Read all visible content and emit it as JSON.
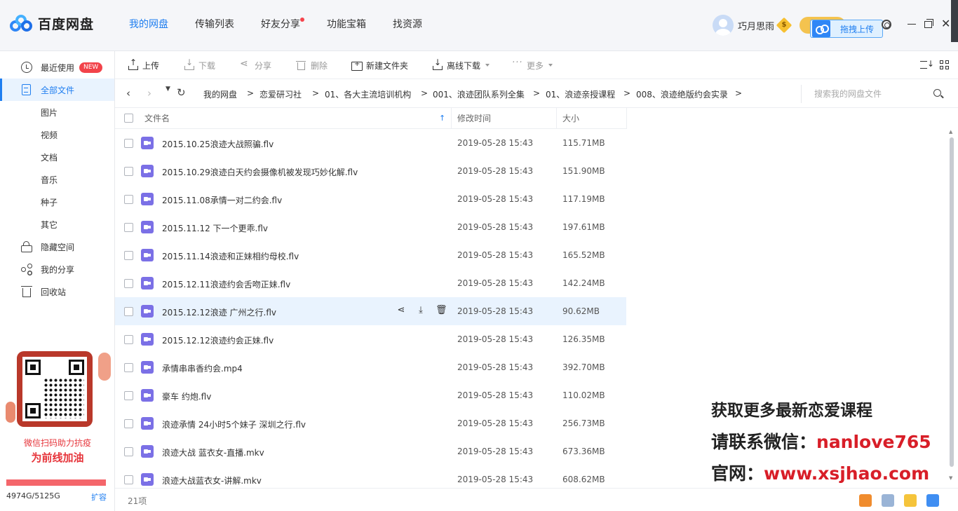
{
  "app": {
    "title": "百度网盘"
  },
  "topnav": [
    {
      "label": "我的网盘",
      "active": true
    },
    {
      "label": "传输列表",
      "active": false
    },
    {
      "label": "好友分享",
      "active": false,
      "dot": true
    },
    {
      "label": "功能宝箱",
      "active": false
    },
    {
      "label": "找资源",
      "active": false
    }
  ],
  "user": {
    "name": "巧月思雨",
    "coin": "$"
  },
  "upload_button": "拖拽上传",
  "sidebar": {
    "items": [
      {
        "label": "最近使用",
        "icon": "clock-icon",
        "badge": "NEW"
      },
      {
        "label": "全部文件",
        "icon": "document-icon",
        "active": true
      },
      {
        "label": "图片"
      },
      {
        "label": "视频"
      },
      {
        "label": "文档"
      },
      {
        "label": "音乐"
      },
      {
        "label": "种子"
      },
      {
        "label": "其它"
      },
      {
        "label": "隐藏空间",
        "icon": "lock-icon"
      },
      {
        "label": "我的分享",
        "icon": "share-icon"
      },
      {
        "label": "回收站",
        "icon": "trash-icon"
      }
    ],
    "promo": {
      "line1": "微信扫码助力抗疫",
      "line2": "为前线加油"
    },
    "quota": {
      "text": "4974G/5125G",
      "expand": "扩容",
      "used_fraction": 0.9705
    }
  },
  "toolbar": {
    "upload": "上传",
    "download": "下载",
    "share": "分享",
    "delete": "删除",
    "new_folder": "新建文件夹",
    "offline_download": "离线下载",
    "more": "更多"
  },
  "path": {
    "crumbs": [
      "我的网盘",
      "恋爱研习社",
      "01、各大主流培训机构",
      "001、浪迹团队系列全集",
      "01、浪迹亲授课程",
      "008、浪迹绝版约会实录"
    ],
    "search_placeholder": "搜索我的网盘文件"
  },
  "list": {
    "headers": {
      "name": "文件名",
      "modified": "修改时间",
      "size": "大小"
    },
    "files": [
      {
        "name": "2015.10.25浪迹大战照骗.flv",
        "modified": "2019-05-28 15:43",
        "size": "115.71MB"
      },
      {
        "name": "2015.10.29浪迹白天约会摄像机被发现巧妙化解.flv",
        "modified": "2019-05-28 15:43",
        "size": "151.90MB"
      },
      {
        "name": "2015.11.08承情一对二约会.flv",
        "modified": "2019-05-28 15:43",
        "size": "117.19MB"
      },
      {
        "name": "2015.11.12 下一个更乖.flv",
        "modified": "2019-05-28 15:43",
        "size": "197.61MB"
      },
      {
        "name": "2015.11.14浪迹和正妹相约母校.flv",
        "modified": "2019-05-28 15:43",
        "size": "165.52MB"
      },
      {
        "name": "2015.12.11浪迹约会舌吻正妹.flv",
        "modified": "2019-05-28 15:43",
        "size": "142.24MB"
      },
      {
        "name": "2015.12.12浪迹 广州之行.flv",
        "modified": "2019-05-28 15:43",
        "size": "90.62MB",
        "hover": true
      },
      {
        "name": "2015.12.12浪迹约会正妹.flv",
        "modified": "2019-05-28 15:43",
        "size": "126.35MB"
      },
      {
        "name": "承情串串香约会.mp4",
        "modified": "2019-05-28 15:43",
        "size": "392.70MB"
      },
      {
        "name": "豪车 约炮.flv",
        "modified": "2019-05-28 15:43",
        "size": "110.02MB"
      },
      {
        "name": "浪迹承情 24小时5个妹子 深圳之行.flv",
        "modified": "2019-05-28 15:43",
        "size": "256.73MB"
      },
      {
        "name": "浪迹大战 蓝衣女-直播.mkv",
        "modified": "2019-05-28 15:43",
        "size": "673.36MB"
      },
      {
        "name": "浪迹大战蓝衣女-讲解.mkv",
        "modified": "2019-05-28 15:43",
        "size": "608.62MB"
      }
    ],
    "count": "21项"
  },
  "watermark": {
    "line1": "获取更多最新恋爱课程",
    "line2_prefix": "请联系微信：",
    "line2_value": "nanlove765",
    "line3_prefix": "官网：",
    "line3_value": "www.xsjhao.com"
  },
  "colors": {
    "accent": "#1f7ef0",
    "video_icon": "#7b70e6",
    "quota_bar": "#f4666b",
    "watermark_red": "#d81e28"
  }
}
